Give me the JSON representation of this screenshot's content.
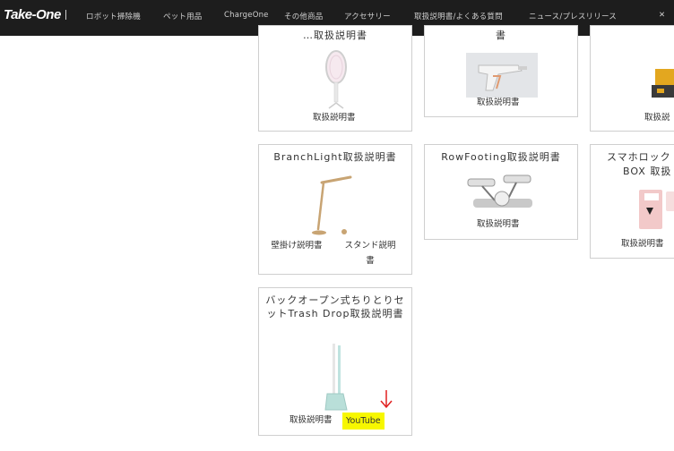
{
  "header": {
    "logo": "Take-One",
    "nav": [
      "ロボット掃除機",
      "ペット用品",
      "ChargeOne",
      "その他商品",
      "アクセサリー",
      "取扱説明書/よくある質問",
      "ニュース/プレスリリース"
    ]
  },
  "cards": {
    "swatter": {
      "title": "…取扱説明書",
      "link": "取扱説明書"
    },
    "spraygun": {
      "title": "書",
      "link": "取扱説明書"
    },
    "third": {
      "link": "取扱説"
    },
    "branchlight": {
      "title": "BranchLight取扱説明書",
      "link1": "壁掛け説明書",
      "link2": "スタンド説明書"
    },
    "rowfooting": {
      "title": "RowFooting取扱説明書",
      "link": "取扱説明書"
    },
    "smalock": {
      "title_line1": "スマホロック",
      "title_line2": "BOX 取扱",
      "link": "取扱説明書"
    },
    "trashdrop": {
      "title": "バックオープン式ちりとりセットTrash Drop取扱説明書",
      "link": "取扱説明書",
      "youtube": "YouTube"
    }
  },
  "colors": {
    "navbar": "#1d1d1d",
    "highlight": "#f7f700",
    "annotation_arrow": "#e02020",
    "card_border": "#cfcfcf"
  }
}
